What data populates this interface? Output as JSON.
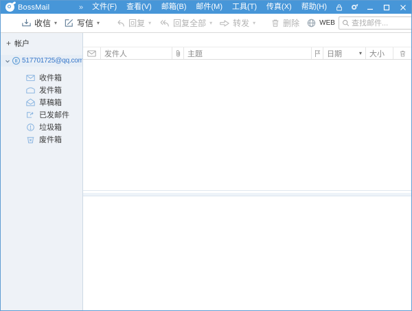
{
  "titlebar": {
    "app_name": "BossMail",
    "menus": [
      "文件(F)",
      "查看(V)",
      "邮箱(B)",
      "邮件(M)",
      "工具(T)",
      "传真(X)",
      "帮助(H)"
    ]
  },
  "toolbar": {
    "receive_label": "收信",
    "compose_label": "写信",
    "reply_label": "回复",
    "reply_all_label": "回复全部",
    "forward_label": "转发",
    "delete_label": "删除",
    "web_label": "WEB",
    "search_placeholder": "查找邮件..."
  },
  "sidebar": {
    "accounts_header": "帐户",
    "add_symbol": "+",
    "account_email": "517701725@qq.com",
    "folders": [
      "收件箱",
      "发件箱",
      "草稿箱",
      "已发邮件",
      "垃圾箱",
      "废件箱"
    ]
  },
  "list": {
    "columns": {
      "sender": "发件人",
      "subject": "主题",
      "date": "日期",
      "size": "大小"
    },
    "rows": []
  },
  "icons": {
    "dropdown_caret": "▾",
    "overflow_chevron": "»",
    "search_more": "»"
  },
  "colors": {
    "titlebar_blue": "#4796d8",
    "sidebar_bg": "#eef2f7",
    "account_link_blue": "#3576c9",
    "folder_icon_blue": "#87b3e0",
    "window_border": "#5f9cd2"
  }
}
